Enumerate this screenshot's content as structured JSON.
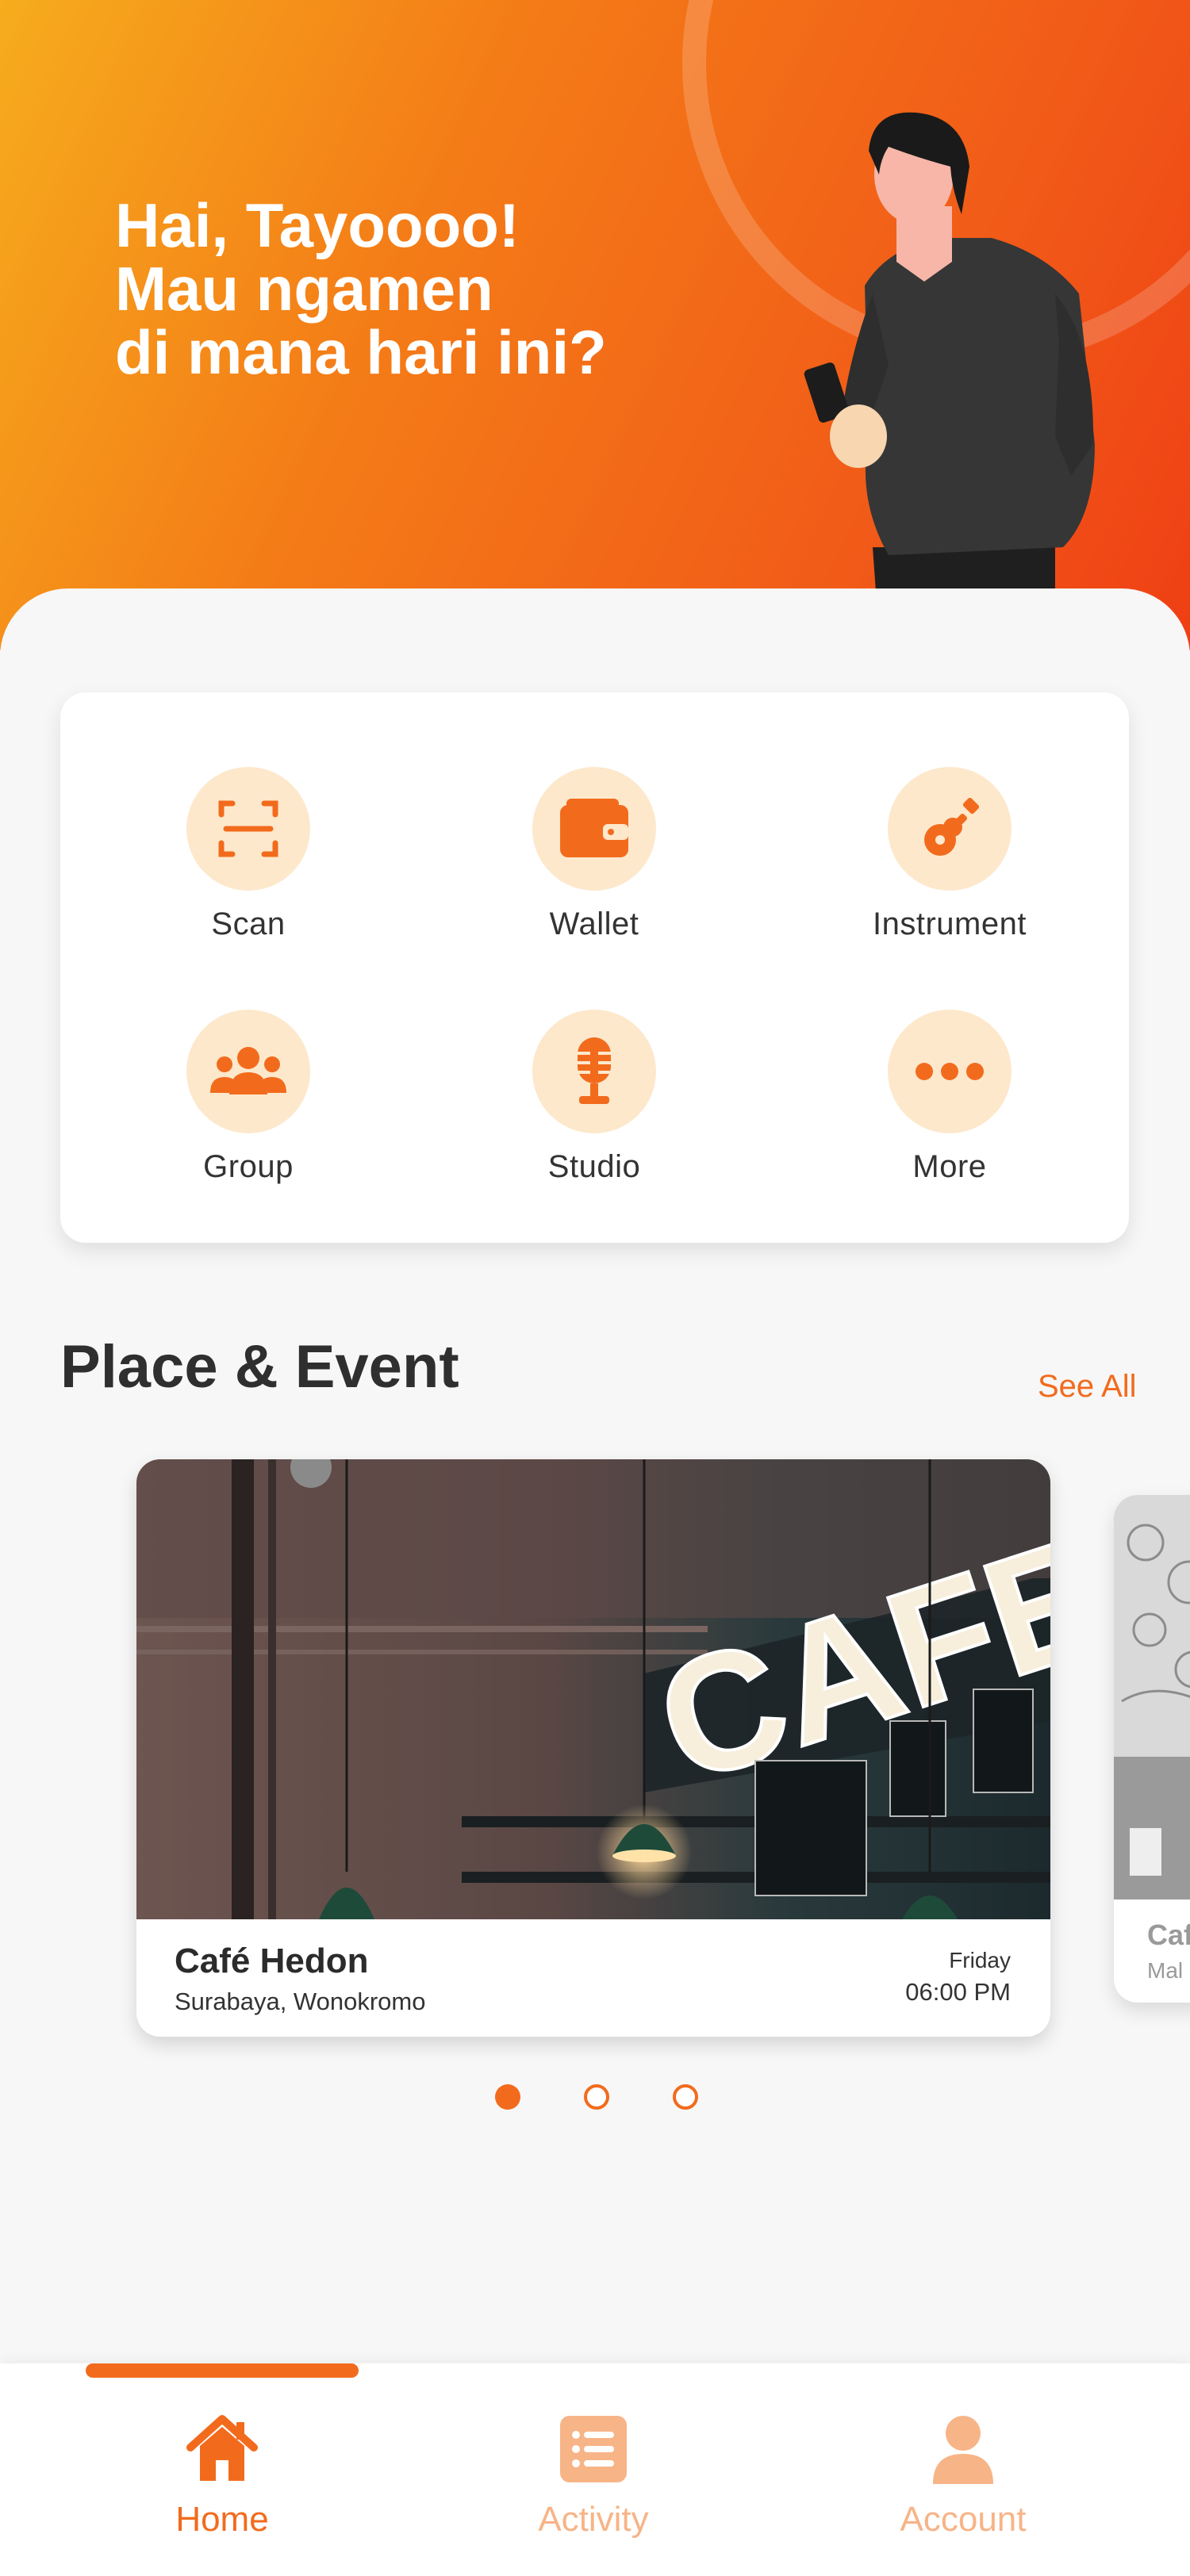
{
  "header": {
    "greeting_lines": [
      "Hai, Tayoooo!",
      "Mau ngamen",
      "di mana hari ini?"
    ]
  },
  "menu": {
    "items": [
      {
        "label": "Scan",
        "icon": "scan-icon"
      },
      {
        "label": "Wallet",
        "icon": "wallet-icon"
      },
      {
        "label": "Instrument",
        "icon": "guitar-icon"
      },
      {
        "label": "Group",
        "icon": "group-icon"
      },
      {
        "label": "Studio",
        "icon": "microphone-icon"
      },
      {
        "label": "More",
        "icon": "more-dots-icon"
      }
    ]
  },
  "section": {
    "title": "Place & Event",
    "see_all": "See All"
  },
  "events": [
    {
      "name": "Café Hedon",
      "location": "Surabaya, Wonokromo",
      "day": "Friday",
      "time": "06:00 PM",
      "sign_text": "CAFE"
    },
    {
      "name": "Caf",
      "location": "Mal"
    }
  ],
  "carousel": {
    "count": 3,
    "active_index": 0
  },
  "nav": {
    "items": [
      {
        "label": "Home",
        "icon": "home-icon",
        "active": true
      },
      {
        "label": "Activity",
        "icon": "list-icon",
        "active": false
      },
      {
        "label": "Account",
        "icon": "user-icon",
        "active": false
      }
    ]
  },
  "colors": {
    "accent": "#f26b1d",
    "accent_light": "#fde8cc",
    "inactive_nav": "#f7b487",
    "header_gradient": [
      "#f6ac1d",
      "#f47c17",
      "#ef3f14"
    ]
  }
}
